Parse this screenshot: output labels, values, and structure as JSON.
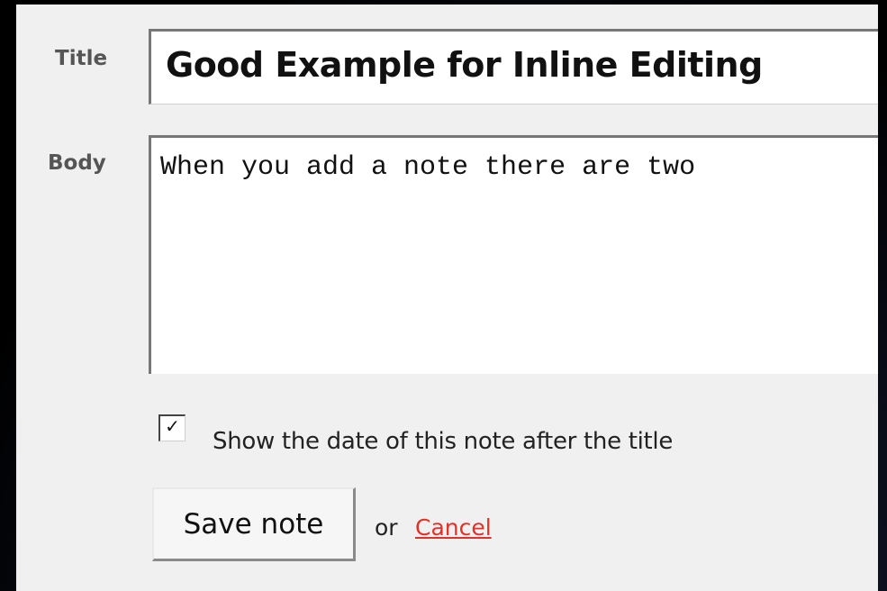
{
  "form": {
    "title_label": "Title",
    "title_value": "Good Example for Inline Editing",
    "body_label": "Body",
    "body_value": "When you add a note there are two",
    "show_date_checked": true,
    "show_date_check_glyph": "✓",
    "show_date_label": "Show the date of this note after the title",
    "save_label": "Save note",
    "or_text": "or",
    "cancel_label": "Cancel"
  },
  "colors": {
    "cancel_link": "#e0322a",
    "panel_background": "#f0f0f0"
  }
}
